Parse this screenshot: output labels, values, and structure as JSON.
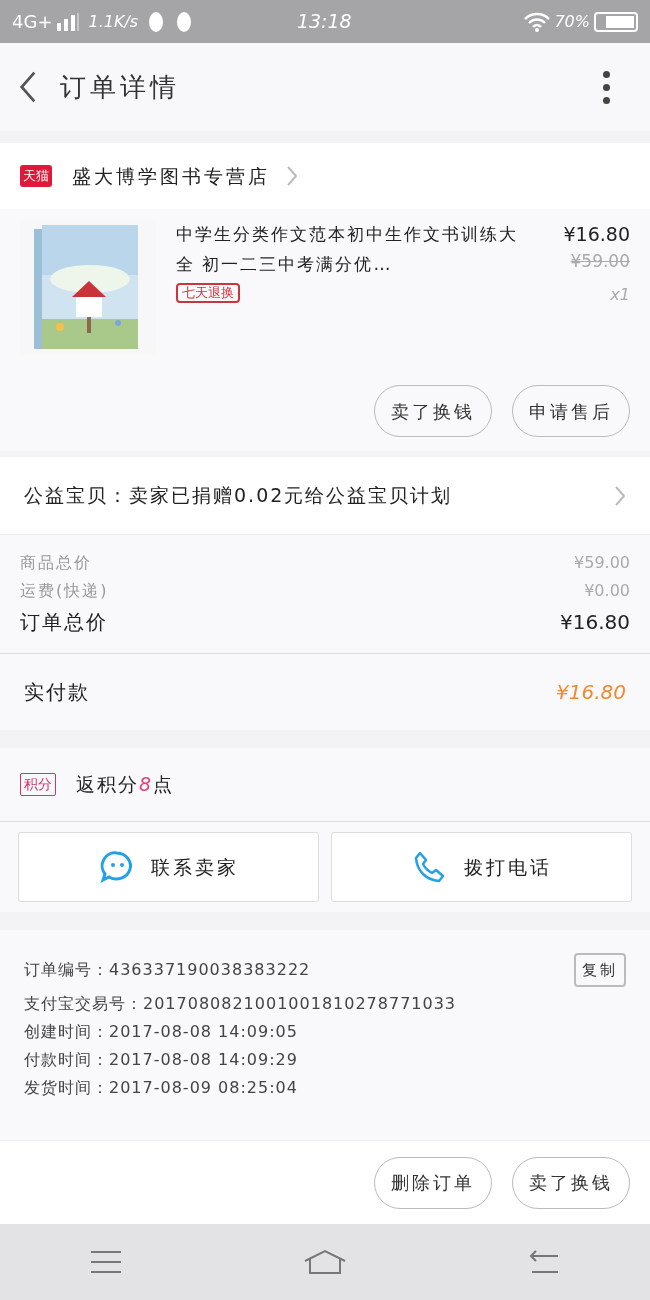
{
  "status_bar": {
    "network": "4G+",
    "speed": "1.1K/s",
    "time": "13:18",
    "battery": "70%"
  },
  "header": {
    "title": "订单详情"
  },
  "shop": {
    "badge": "天猫",
    "name": "盛大博学图书专营店"
  },
  "product": {
    "title": "中学生分类作文范本初中生作文书训练大全 初一二三中考满分优…",
    "tag": "七天退换",
    "price": "¥16.80",
    "original_price": "¥59.00",
    "quantity": "x1",
    "buttons": [
      "卖了换钱",
      "申请售后"
    ]
  },
  "charity": {
    "text": "公益宝贝：卖家已捐赠0.02元给公益宝贝计划"
  },
  "costs": [
    {
      "label": "商品总价",
      "value": "¥59.00",
      "kind": "minor"
    },
    {
      "label": "运费(快递)",
      "value": "¥0.00",
      "kind": "minor"
    },
    {
      "label": "订单总价",
      "value": "¥16.80",
      "kind": "major"
    }
  ],
  "paid": {
    "label": "实付款",
    "value": "¥16.80"
  },
  "points": {
    "badge": "积分",
    "prefix": "返积分",
    "amount": "8",
    "suffix": "点"
  },
  "contact_buttons": [
    {
      "label": "联系卖家",
      "kind": "chat"
    },
    {
      "label": "拨打电话",
      "kind": "phone"
    }
  ],
  "order_info": {
    "copy_button": "复制",
    "lines": [
      "订单编号：436337190038383222",
      "支付宝交易号：2017080821001001810278771033",
      "创建时间：2017-08-08 14:09:05",
      "付款时间：2017-08-08 14:09:29",
      "发货时间：2017-08-09 08:25:04"
    ]
  },
  "bottom_buttons": [
    "删除订单",
    "卖了换钱"
  ]
}
